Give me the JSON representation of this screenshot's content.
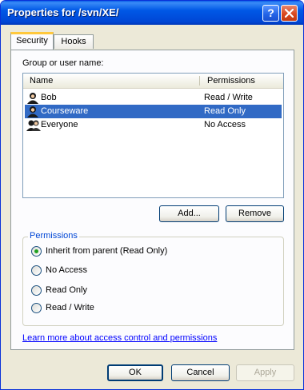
{
  "window": {
    "title": "Properties for /svn/XE/",
    "help_glyph": "?"
  },
  "tabs": [
    {
      "label": "Security",
      "active": true
    },
    {
      "label": "Hooks",
      "active": false
    }
  ],
  "users_section": {
    "label": "Group or user name:",
    "columns": {
      "name": "Name",
      "permissions": "Permissions"
    },
    "rows": [
      {
        "name": "Bob",
        "permissions": "Read / Write",
        "icon": "user-icon",
        "selected": false
      },
      {
        "name": "Courseware",
        "permissions": "Read Only",
        "icon": "user-icon",
        "selected": true
      },
      {
        "name": "Everyone",
        "permissions": "No Access",
        "icon": "group-icon",
        "selected": false
      }
    ],
    "add_label": "Add...",
    "remove_label": "Remove"
  },
  "permissions": {
    "legend": "Permissions",
    "options": [
      {
        "label": "Inherit from parent (Read Only)",
        "checked": true
      },
      {
        "label": "No Access",
        "checked": false
      },
      {
        "label": "Read Only",
        "checked": false
      },
      {
        "label": "Read / Write",
        "checked": false
      }
    ]
  },
  "help_link": "Learn more about access control and permissions",
  "footer": {
    "ok_label": "OK",
    "cancel_label": "Cancel",
    "apply_label": "Apply"
  },
  "colors": {
    "titlebar": "#0058e6",
    "selection": "#316ac5",
    "link": "#0000ff",
    "radio_dot": "#21a121",
    "dialog_bg": "#ece9d8"
  }
}
